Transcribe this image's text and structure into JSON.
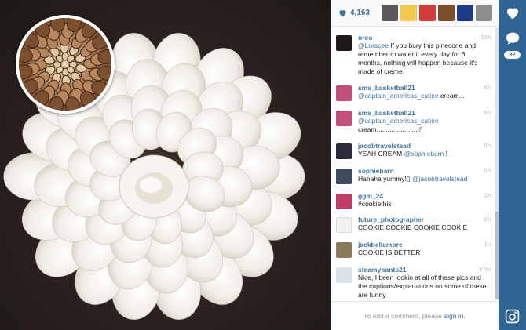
{
  "post": {
    "likes_count": "4,163",
    "heart_icon": "heart-icon"
  },
  "likers": [
    {
      "name": "liker-1",
      "color": "#5b5b5b"
    },
    {
      "name": "liker-2",
      "color": "#f2c94c"
    },
    {
      "name": "liker-3",
      "color": "#d33b3b"
    },
    {
      "name": "liker-4",
      "color": "#7a4e2d"
    },
    {
      "name": "liker-5",
      "color": "#1e3a8a"
    },
    {
      "name": "liker-6",
      "color": "#8e8e8e"
    }
  ],
  "comments": [
    {
      "user": "oreo",
      "time": "10h",
      "text": "@Lorscee If you bury this pinecone and remember to water it every day for 6 months, nothing will happen because it's made of creme.",
      "avatar_color": "#1e1a1a"
    },
    {
      "user": "sms_basketball21",
      "time": "6h",
      "text": "@captain_americas_cutiee cream...",
      "avatar_color": "#c0507a"
    },
    {
      "user": "sms_basketball21",
      "time": "6h",
      "text": "@captain_americas_cutiee cream.......................▯",
      "avatar_color": "#c0507a"
    },
    {
      "user": "jacobtravelstead",
      "time": "5h",
      "text": "YEAH CREAM @sophiebarn !",
      "avatar_color": "#2a2a3a"
    },
    {
      "user": "sophiebarn",
      "time": "5h",
      "text": "Hahaha yummy!▯ @jacobtravelstead",
      "avatar_color": "#3e4a5e"
    },
    {
      "user": "ggm_24",
      "time": "2h",
      "text": "#cookiethis",
      "avatar_color": "#c03a6a"
    },
    {
      "user": "future_photographer",
      "time": "2h",
      "text": "COOKIE COOKIE COOKIE COOKIE",
      "avatar_color": "#f2f2f2"
    },
    {
      "user": "jackbellemore",
      "time": "1h",
      "text": "COOKIE IS BETTER",
      "avatar_color": "#8a7a5a"
    },
    {
      "user": "steamypants21",
      "time": "57m",
      "text": "Nice, I been lookin at all of these pics and the captions/explanations on some of these are funny",
      "avatar_color": "#dce3ea"
    }
  ],
  "add_comment": {
    "prefix": "To add a comment, please",
    "link": "sign in."
  },
  "actions": {
    "comment_count": "32"
  },
  "colors": {
    "link_blue": "#3f729b",
    "action_bar": "#2f6493"
  }
}
